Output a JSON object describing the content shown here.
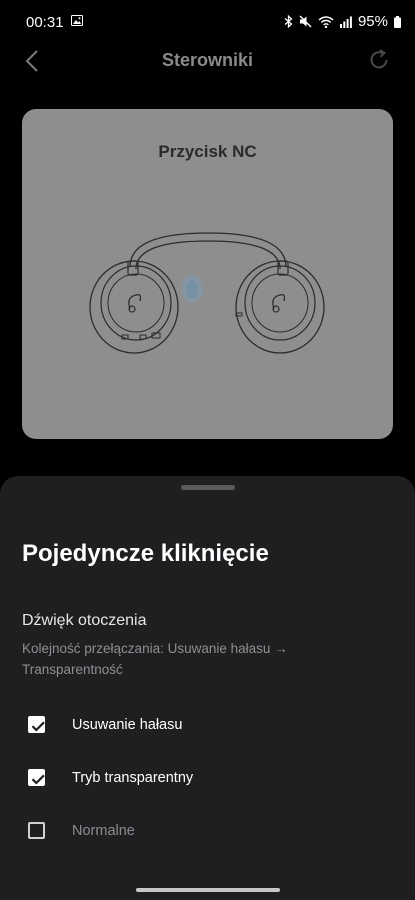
{
  "status_bar": {
    "time": "00:31",
    "battery": "95%",
    "icons": [
      "gallery-icon",
      "bluetooth-icon",
      "mute-icon",
      "wifi-icon",
      "signal-icon",
      "battery-icon"
    ]
  },
  "header": {
    "title": "Sterowniki",
    "back_icon": "chevron-left-icon",
    "reset_icon": "refresh-icon"
  },
  "preview": {
    "title": "Przycisk NC",
    "image": "headphones-illustration"
  },
  "sheet": {
    "title": "Pojedyncze kliknięcie",
    "section_title": "Dźwięk otoczenia",
    "section_desc": "Kolejność przełączania: Usuwanie hałasu → Transparentność",
    "options": [
      {
        "label": "Usuwanie hałasu",
        "checked": true,
        "enabled": true
      },
      {
        "label": "Tryb transparentny",
        "checked": true,
        "enabled": true
      },
      {
        "label": "Normalne",
        "checked": false,
        "enabled": false
      }
    ]
  },
  "colors": {
    "background": "#000000",
    "sheet": "#1f1f21",
    "card": "#8e8e8e",
    "muted_text": "#8f8f93"
  }
}
